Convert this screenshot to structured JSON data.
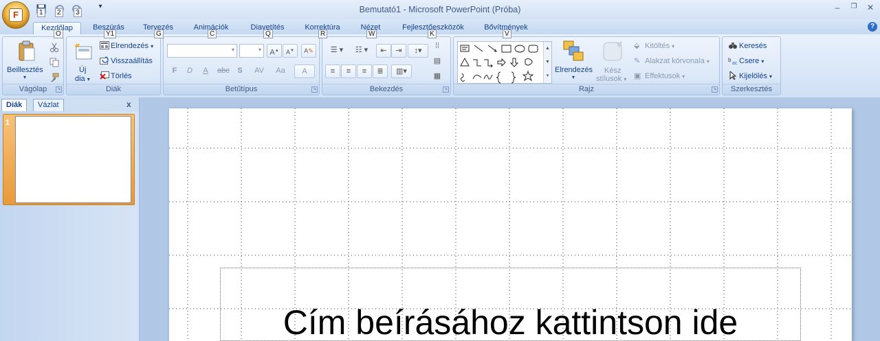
{
  "window": {
    "title": "Bemutató1 - Microsoft PowerPoint (Próba)",
    "controls": {
      "minimize": "–",
      "restore": "❐",
      "close": "✕"
    }
  },
  "office_button": {
    "letter": "F"
  },
  "quick_access": [
    {
      "name": "save",
      "keytip": "1"
    },
    {
      "name": "undo",
      "keytip": "2"
    },
    {
      "name": "redo",
      "keytip": "3"
    }
  ],
  "tabs": [
    {
      "label": "Kezdőlap",
      "keytip": "O",
      "active": true
    },
    {
      "label": "Beszúrás",
      "keytip": "Y1"
    },
    {
      "label": "Tervezés",
      "keytip": "G"
    },
    {
      "label": "Animációk",
      "keytip": "C"
    },
    {
      "label": "Diavetítés",
      "keytip": "Q"
    },
    {
      "label": "Korrektúra",
      "keytip": "R"
    },
    {
      "label": "Nézet",
      "keytip": "W"
    },
    {
      "label": "Fejlesztőeszközök",
      "keytip": "K"
    },
    {
      "label": "Bővítmények",
      "keytip": "V"
    }
  ],
  "groups": {
    "vagolap": {
      "label": "Vágólap",
      "paste": "Beillesztés"
    },
    "diak": {
      "label": "Diák",
      "new_slide_1": "Új",
      "new_slide_2": "dia",
      "layout": "Elrendezés",
      "reset": "Visszaállítás",
      "delete": "Törlés"
    },
    "betutipus": {
      "label": "Betűtípus",
      "bold": "F",
      "italic": "D",
      "underline": "A",
      "strike": "abc",
      "shadow": "S",
      "spacing": "AV",
      "case": "Aa",
      "color": "A"
    },
    "bekezdes": {
      "label": "Bekezdés"
    },
    "rajz": {
      "label": "Rajz",
      "arrange": "Elrendezés",
      "quick_styles_1": "Kész",
      "quick_styles_2": "stílusok",
      "fill": "Kitöltés",
      "outline": "Alakzat körvonala",
      "effects": "Effektusok"
    },
    "szerkesztes": {
      "label": "Szerkesztés",
      "find": "Keresés",
      "replace": "Csere",
      "select": "Kijelölés"
    }
  },
  "panel": {
    "tab_slides": "Diák",
    "tab_outline": "Vázlat",
    "close": "x",
    "slide_number": "1"
  },
  "slide": {
    "title_placeholder": "Cím beírásához kattintson ide"
  },
  "colors": {
    "ribbon": "#dce8f8",
    "selection": "#f3b05a",
    "canvas": "#b0c7e6"
  }
}
